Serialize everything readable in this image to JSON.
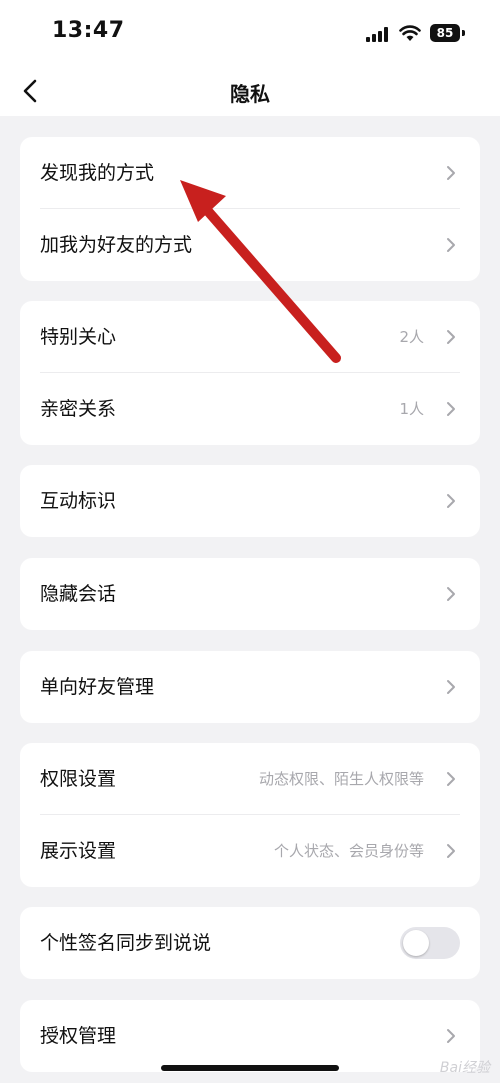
{
  "status_bar": {
    "time": "13:47",
    "battery": "85"
  },
  "nav": {
    "title": "隐私"
  },
  "groups": [
    {
      "rows": [
        {
          "label": "发现我的方式"
        },
        {
          "label": "加我为好友的方式"
        }
      ]
    },
    {
      "rows": [
        {
          "label": "特别关心",
          "value": "2人"
        },
        {
          "label": "亲密关系",
          "value": "1人"
        }
      ]
    },
    {
      "rows": [
        {
          "label": "互动标识"
        }
      ]
    },
    {
      "rows": [
        {
          "label": "隐藏会话"
        }
      ]
    },
    {
      "rows": [
        {
          "label": "单向好友管理"
        }
      ]
    },
    {
      "rows": [
        {
          "label": "权限设置",
          "value": "动态权限、陌生人权限等"
        },
        {
          "label": "展示设置",
          "value": "个人状态、会员身份等"
        }
      ]
    },
    {
      "rows": [
        {
          "label": "个性签名同步到说说",
          "toggle": false
        }
      ]
    },
    {
      "rows": [
        {
          "label": "授权管理"
        }
      ]
    }
  ],
  "annotation": {
    "arrow_color": "#c8201e"
  },
  "watermark": {
    "text": "Bai经验"
  }
}
